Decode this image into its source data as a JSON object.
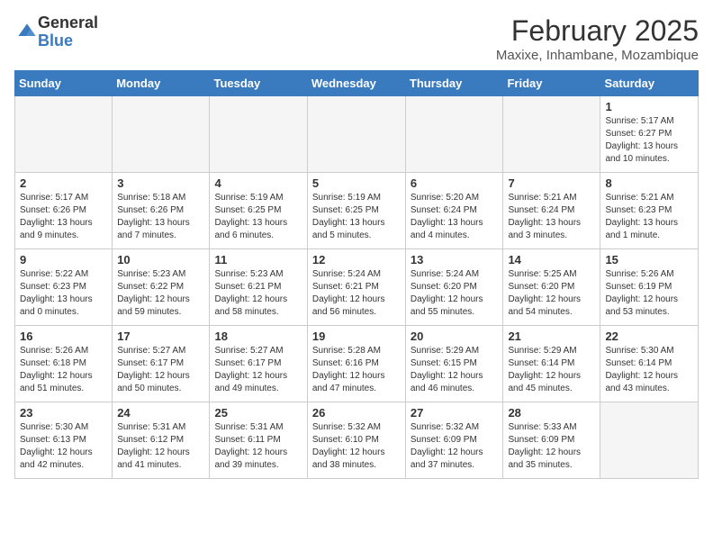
{
  "header": {
    "logo_general": "General",
    "logo_blue": "Blue",
    "month_title": "February 2025",
    "subtitle": "Maxixe, Inhambane, Mozambique"
  },
  "days_of_week": [
    "Sunday",
    "Monday",
    "Tuesday",
    "Wednesday",
    "Thursday",
    "Friday",
    "Saturday"
  ],
  "weeks": [
    [
      {
        "num": "",
        "info": ""
      },
      {
        "num": "",
        "info": ""
      },
      {
        "num": "",
        "info": ""
      },
      {
        "num": "",
        "info": ""
      },
      {
        "num": "",
        "info": ""
      },
      {
        "num": "",
        "info": ""
      },
      {
        "num": "1",
        "info": "Sunrise: 5:17 AM\nSunset: 6:27 PM\nDaylight: 13 hours\nand 10 minutes."
      }
    ],
    [
      {
        "num": "2",
        "info": "Sunrise: 5:17 AM\nSunset: 6:26 PM\nDaylight: 13 hours\nand 9 minutes."
      },
      {
        "num": "3",
        "info": "Sunrise: 5:18 AM\nSunset: 6:26 PM\nDaylight: 13 hours\nand 7 minutes."
      },
      {
        "num": "4",
        "info": "Sunrise: 5:19 AM\nSunset: 6:25 PM\nDaylight: 13 hours\nand 6 minutes."
      },
      {
        "num": "5",
        "info": "Sunrise: 5:19 AM\nSunset: 6:25 PM\nDaylight: 13 hours\nand 5 minutes."
      },
      {
        "num": "6",
        "info": "Sunrise: 5:20 AM\nSunset: 6:24 PM\nDaylight: 13 hours\nand 4 minutes."
      },
      {
        "num": "7",
        "info": "Sunrise: 5:21 AM\nSunset: 6:24 PM\nDaylight: 13 hours\nand 3 minutes."
      },
      {
        "num": "8",
        "info": "Sunrise: 5:21 AM\nSunset: 6:23 PM\nDaylight: 13 hours\nand 1 minute."
      }
    ],
    [
      {
        "num": "9",
        "info": "Sunrise: 5:22 AM\nSunset: 6:23 PM\nDaylight: 13 hours\nand 0 minutes."
      },
      {
        "num": "10",
        "info": "Sunrise: 5:23 AM\nSunset: 6:22 PM\nDaylight: 12 hours\nand 59 minutes."
      },
      {
        "num": "11",
        "info": "Sunrise: 5:23 AM\nSunset: 6:21 PM\nDaylight: 12 hours\nand 58 minutes."
      },
      {
        "num": "12",
        "info": "Sunrise: 5:24 AM\nSunset: 6:21 PM\nDaylight: 12 hours\nand 56 minutes."
      },
      {
        "num": "13",
        "info": "Sunrise: 5:24 AM\nSunset: 6:20 PM\nDaylight: 12 hours\nand 55 minutes."
      },
      {
        "num": "14",
        "info": "Sunrise: 5:25 AM\nSunset: 6:20 PM\nDaylight: 12 hours\nand 54 minutes."
      },
      {
        "num": "15",
        "info": "Sunrise: 5:26 AM\nSunset: 6:19 PM\nDaylight: 12 hours\nand 53 minutes."
      }
    ],
    [
      {
        "num": "16",
        "info": "Sunrise: 5:26 AM\nSunset: 6:18 PM\nDaylight: 12 hours\nand 51 minutes."
      },
      {
        "num": "17",
        "info": "Sunrise: 5:27 AM\nSunset: 6:17 PM\nDaylight: 12 hours\nand 50 minutes."
      },
      {
        "num": "18",
        "info": "Sunrise: 5:27 AM\nSunset: 6:17 PM\nDaylight: 12 hours\nand 49 minutes."
      },
      {
        "num": "19",
        "info": "Sunrise: 5:28 AM\nSunset: 6:16 PM\nDaylight: 12 hours\nand 47 minutes."
      },
      {
        "num": "20",
        "info": "Sunrise: 5:29 AM\nSunset: 6:15 PM\nDaylight: 12 hours\nand 46 minutes."
      },
      {
        "num": "21",
        "info": "Sunrise: 5:29 AM\nSunset: 6:14 PM\nDaylight: 12 hours\nand 45 minutes."
      },
      {
        "num": "22",
        "info": "Sunrise: 5:30 AM\nSunset: 6:14 PM\nDaylight: 12 hours\nand 43 minutes."
      }
    ],
    [
      {
        "num": "23",
        "info": "Sunrise: 5:30 AM\nSunset: 6:13 PM\nDaylight: 12 hours\nand 42 minutes."
      },
      {
        "num": "24",
        "info": "Sunrise: 5:31 AM\nSunset: 6:12 PM\nDaylight: 12 hours\nand 41 minutes."
      },
      {
        "num": "25",
        "info": "Sunrise: 5:31 AM\nSunset: 6:11 PM\nDaylight: 12 hours\nand 39 minutes."
      },
      {
        "num": "26",
        "info": "Sunrise: 5:32 AM\nSunset: 6:10 PM\nDaylight: 12 hours\nand 38 minutes."
      },
      {
        "num": "27",
        "info": "Sunrise: 5:32 AM\nSunset: 6:09 PM\nDaylight: 12 hours\nand 37 minutes."
      },
      {
        "num": "28",
        "info": "Sunrise: 5:33 AM\nSunset: 6:09 PM\nDaylight: 12 hours\nand 35 minutes."
      },
      {
        "num": "",
        "info": ""
      }
    ]
  ]
}
